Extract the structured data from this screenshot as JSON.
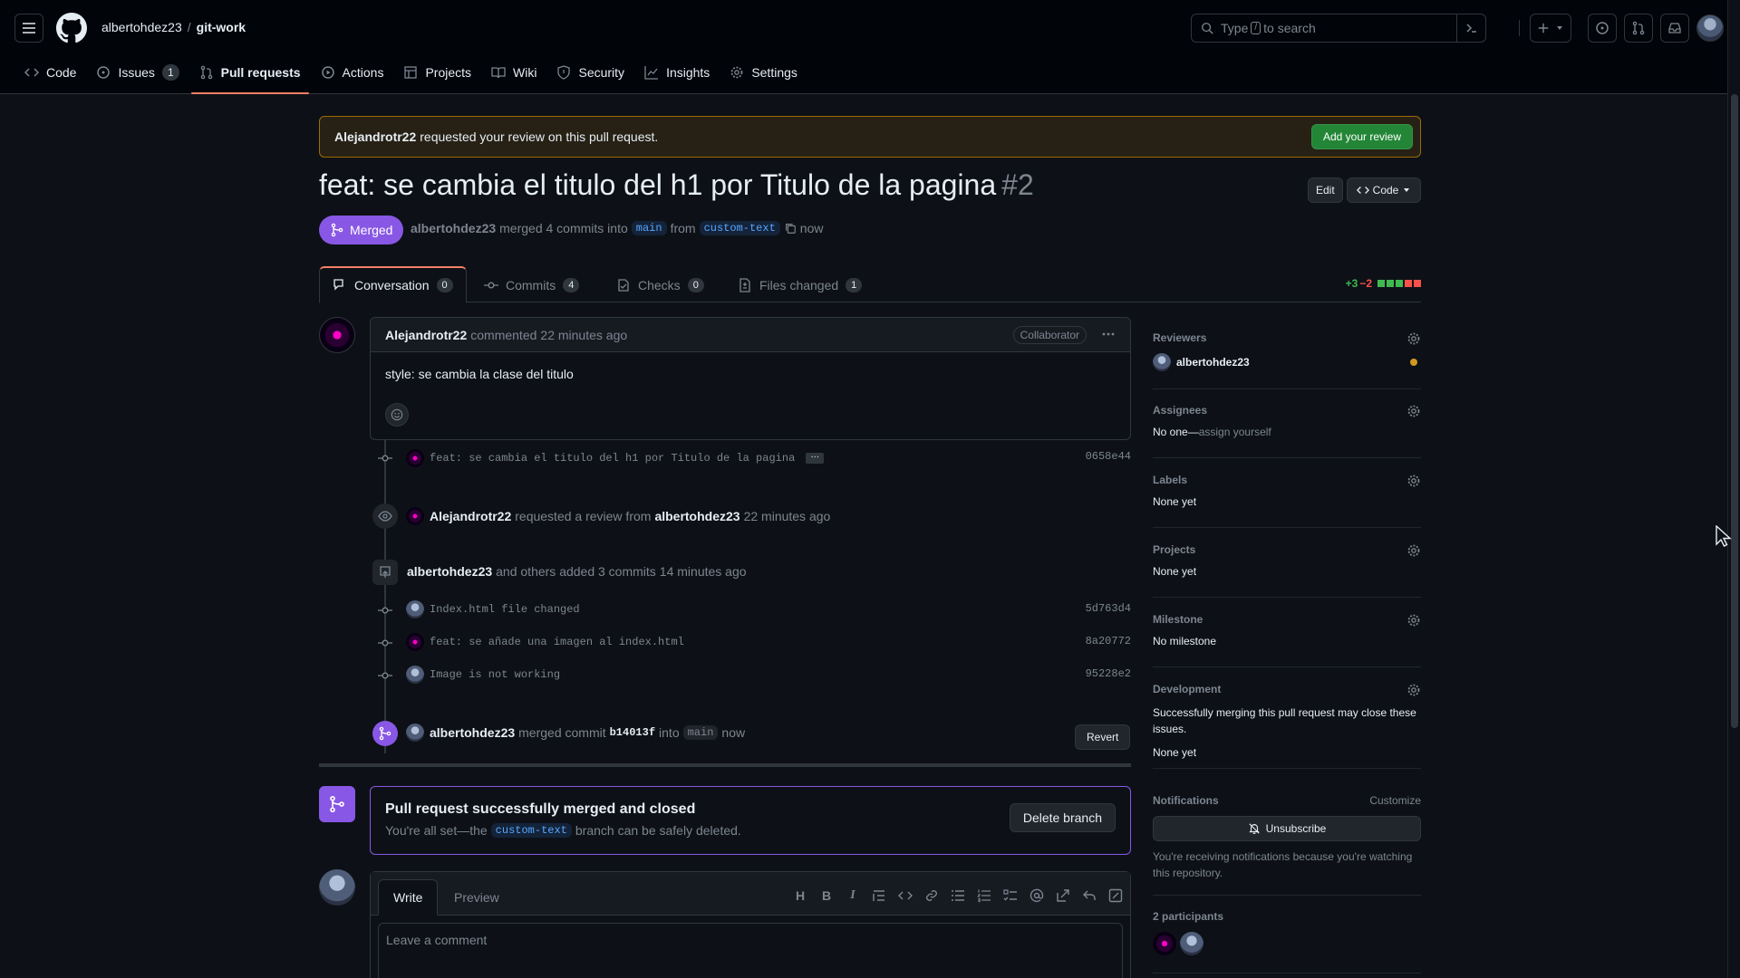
{
  "header": {
    "owner": "albertohdez23",
    "separator": "/",
    "repo": "git-work",
    "search_placeholder_pre": "Type",
    "search_slash": "/",
    "search_placeholder_post": "to search"
  },
  "nav": [
    {
      "label": "Code",
      "icon": "code-icon"
    },
    {
      "label": "Issues",
      "count": "1",
      "icon": "issue-opened-icon"
    },
    {
      "label": "Pull requests",
      "icon": "git-pull-request-icon",
      "active": true
    },
    {
      "label": "Actions",
      "icon": "play-icon"
    },
    {
      "label": "Projects",
      "icon": "table-icon"
    },
    {
      "label": "Wiki",
      "icon": "book-icon"
    },
    {
      "label": "Security",
      "icon": "shield-icon"
    },
    {
      "label": "Insights",
      "icon": "graph-icon"
    },
    {
      "label": "Settings",
      "icon": "gear-icon"
    }
  ],
  "banner": {
    "user": "Alejandrotr22",
    "text": "requested your review on this pull request.",
    "button": "Add your review"
  },
  "pr": {
    "title": "feat: se cambia el titulo del h1 por Titulo de la pagina",
    "number": "#2",
    "edit": "Edit",
    "code": "Code",
    "state": "Merged",
    "author": "albertohdez23",
    "merge_text": "merged 4 commits into",
    "base": "main",
    "from": "from",
    "head": "custom-text",
    "time": "now"
  },
  "tabs": [
    {
      "label": "Conversation",
      "count": "0",
      "icon": "comment-discussion-icon",
      "active": true
    },
    {
      "label": "Commits",
      "count": "4",
      "icon": "git-commit-icon"
    },
    {
      "label": "Checks",
      "count": "0",
      "icon": "checklist-icon"
    },
    {
      "label": "Files changed",
      "count": "1",
      "icon": "file-diff-icon"
    }
  ],
  "diffstat": {
    "added": "+3",
    "removed": "−2",
    "colors": [
      "#3fb950",
      "#3fb950",
      "#3fb950",
      "#f85149",
      "#f85149"
    ]
  },
  "comment": {
    "author": "Alejandrotr22",
    "action": "commented",
    "time": "22 minutes ago",
    "role": "Collaborator",
    "body": "style: se cambia la clase del titulo"
  },
  "timeline": {
    "commit1": {
      "msg": "feat: se cambia el titulo del h1 por Titulo de la pagina",
      "sha": "0658e44"
    },
    "review_req": {
      "user": "Alejandrotr22",
      "text": "requested a review from",
      "target": "albertohdez23",
      "time": "22 minutes ago"
    },
    "added": {
      "user": "albertohdez23",
      "text": "and others added 3 commits",
      "time": "14 minutes ago"
    },
    "commits": [
      {
        "msg": "Index.html file changed",
        "sha": "5d763d4"
      },
      {
        "msg": "feat: se añade una imagen al index.html",
        "sha": "8a20772"
      },
      {
        "msg": "Image is not working",
        "sha": "95228e2"
      }
    ],
    "merged": {
      "user": "albertohdez23",
      "text": "merged commit",
      "sha": "b14013f",
      "into": "into",
      "base": "main",
      "time": "now",
      "revert": "Revert"
    }
  },
  "merge_box": {
    "title": "Pull request successfully merged and closed",
    "pre": "You're all set—the",
    "branch": "custom-text",
    "post": "branch can be safely deleted.",
    "button": "Delete branch"
  },
  "editor": {
    "write": "Write",
    "preview": "Preview",
    "placeholder": "Leave a comment",
    "tools": [
      "H",
      "B",
      "I"
    ]
  },
  "sidebar": {
    "reviewers": {
      "title": "Reviewers",
      "user": "albertohdez23"
    },
    "assignees": {
      "title": "Assignees",
      "value": "No one—",
      "link": "assign yourself"
    },
    "labels": {
      "title": "Labels",
      "value": "None yet"
    },
    "projects": {
      "title": "Projects",
      "value": "None yet"
    },
    "milestone": {
      "title": "Milestone",
      "value": "No milestone"
    },
    "development": {
      "title": "Development",
      "desc": "Successfully merging this pull request may close these issues.",
      "value": "None yet"
    },
    "notifications": {
      "title": "Notifications",
      "customize": "Customize",
      "button": "Unsubscribe",
      "desc": "You're receiving notifications because you're watching this repository."
    },
    "participants": {
      "title": "2 participants"
    }
  }
}
